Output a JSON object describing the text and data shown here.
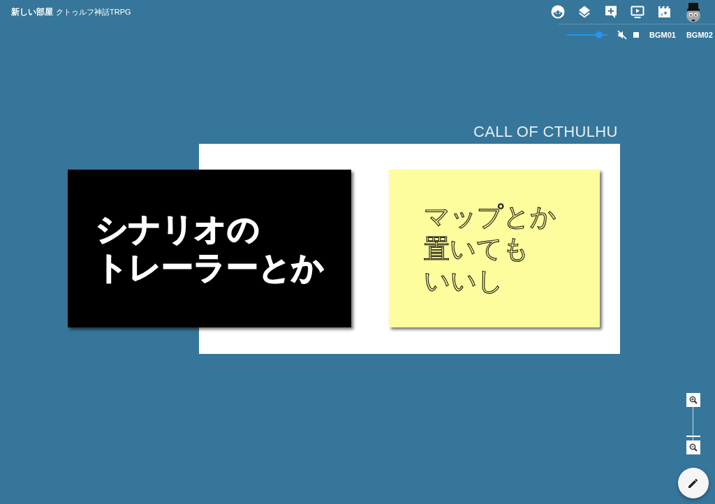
{
  "header": {
    "title": "新しい部屋",
    "subtitle": "クトゥルフ神話TRPG"
  },
  "audio": {
    "volume": {
      "level": 0.8
    },
    "muted": true,
    "tracks": [
      {
        "label": "BGM01"
      },
      {
        "label": "BGM02"
      }
    ]
  },
  "board": {
    "caption": "CALL OF CTHULHU",
    "cards": [
      {
        "kind": "trailer",
        "lines": [
          "シナリオの",
          "トレーラーとか"
        ]
      },
      {
        "kind": "note",
        "lines": [
          "マップとか",
          "置いても",
          "いいし"
        ]
      }
    ]
  },
  "zoom": {
    "level": 0.12
  }
}
